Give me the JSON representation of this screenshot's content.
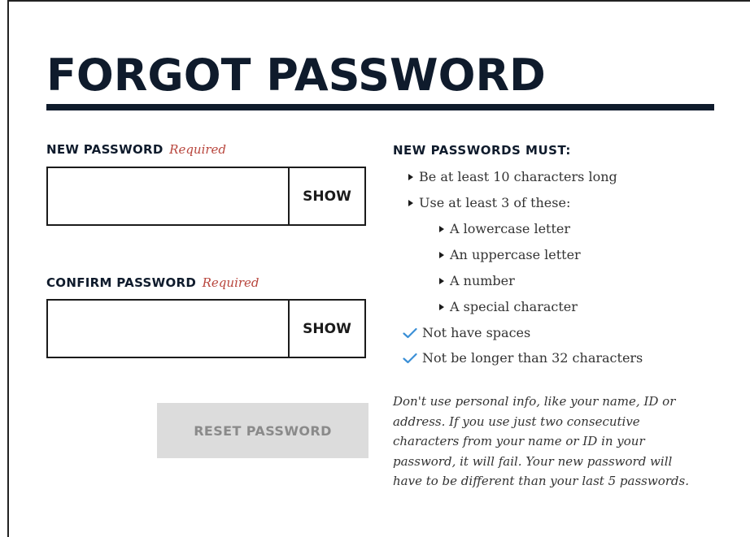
{
  "page": {
    "title": "FORGOT PASSWORD"
  },
  "form": {
    "new_password": {
      "label": "NEW PASSWORD",
      "required_text": "Required",
      "value": "",
      "show_label": "SHOW"
    },
    "confirm_password": {
      "label": "CONFIRM PASSWORD",
      "required_text": "Required",
      "value": "",
      "show_label": "SHOW"
    },
    "reset_button_label": "RESET PASSWORD"
  },
  "rules": {
    "title": "NEW PASSWORDS MUST:",
    "items": [
      {
        "text": "Be at least 10 characters long",
        "marker": "triangle",
        "level": 0
      },
      {
        "text": "Use at least 3 of these:",
        "marker": "triangle",
        "level": 0
      },
      {
        "text": "A lowercase letter",
        "marker": "triangle",
        "level": 1
      },
      {
        "text": "An uppercase letter",
        "marker": "triangle",
        "level": 1
      },
      {
        "text": "A number",
        "marker": "triangle",
        "level": 1
      },
      {
        "text": "A special character",
        "marker": "triangle",
        "level": 1
      },
      {
        "text": "Not have spaces",
        "marker": "check-icon",
        "level": 0
      },
      {
        "text": "Not be longer than 32 characters",
        "marker": "check-icon",
        "level": 0
      }
    ],
    "note": "Don't use personal info, like your name, ID or address. If you use just two consecutive characters from your name or ID in your password, it will fail. Your new password will have to be different than your last 5 passwords."
  },
  "colors": {
    "title": "#0f1b2c",
    "required": "#b8453c",
    "check": "#3a8fd6",
    "disabled_button_bg": "#dcdcdc",
    "disabled_button_text": "#8a8a8a"
  }
}
